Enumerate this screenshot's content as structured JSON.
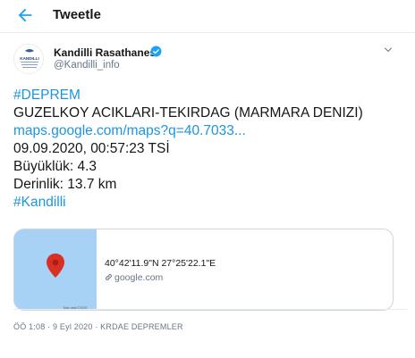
{
  "header": {
    "title": "Tweetle",
    "back_icon": "arrow-left-icon"
  },
  "tweet": {
    "display_name": "Kandilli Rasathanesi",
    "handle": "@Kandilli_info",
    "avatar_text": "KANDILLI",
    "verified_icon": "verified-badge-icon",
    "lines": {
      "hashtag_deprem": "#DEPREM",
      "location": "GUZELKOY ACIKLARI-TEKIRDAG (MARMARA DENIZI)",
      "map_link": "maps.google.com/maps?q=40.7033...",
      "datetime": "09.09.2020, 00:57:23 TSİ",
      "magnitude": "Büyüklük: 4.3",
      "depth": "Derinlik: 13.7 km",
      "hashtag_kandilli": "#Kandilli"
    },
    "card": {
      "coordinates": "40°42'11.9\"N 27°25'22.1\"E",
      "domain": "google.com",
      "map_attribution": "Map data ©2020"
    },
    "meta": {
      "time": "ÖÖ 1:08",
      "separator": " · ",
      "date": "9 Eyl 2020",
      "client": "KRDAE DEPREMLER"
    }
  },
  "colors": {
    "accent": "#1da1f2",
    "link": "#1b95e0",
    "text": "#14171a",
    "secondary": "#657786",
    "border": "#ccd6dd",
    "map_water": "#a7d1f5",
    "pin": "#d93025"
  }
}
